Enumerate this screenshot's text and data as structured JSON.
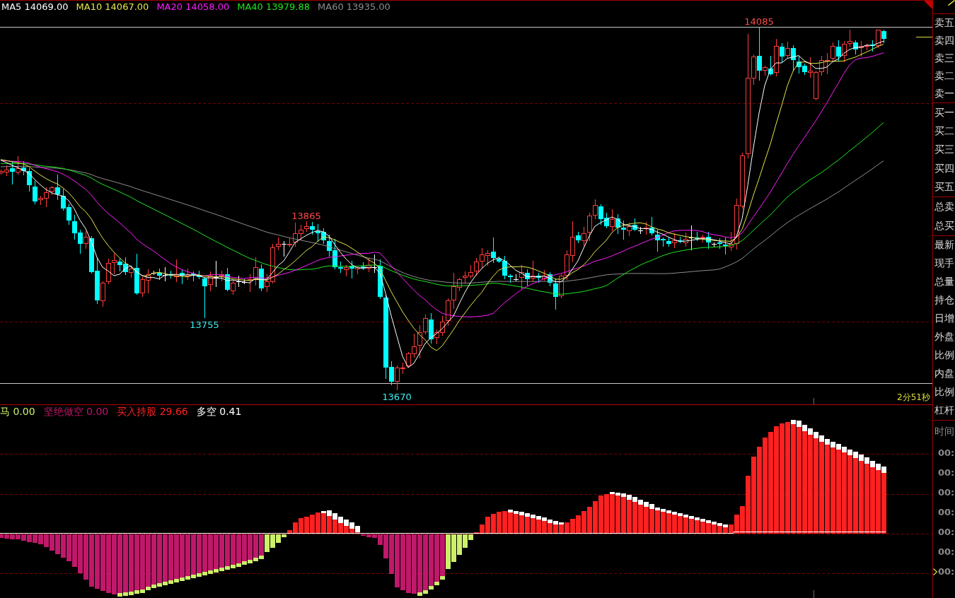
{
  "ma_legend": [
    {
      "text": "MA5 14069.00",
      "color": "#ffffff"
    },
    {
      "text": "MA10 14067.00",
      "color": "#e6e64c"
    },
    {
      "text": "MA20 14058.00",
      "color": "#ff1eff"
    },
    {
      "text": "MA40 13979.88",
      "color": "#1ee61e"
    },
    {
      "text": "MA60 13935.00",
      "color": "#8c8c8c"
    }
  ],
  "main_chart": {
    "price_labels": [
      {
        "text": "14085",
        "kind": "high"
      },
      {
        "text": "13865",
        "kind": "high"
      },
      {
        "text": "13755",
        "kind": "low"
      },
      {
        "text": "13670",
        "kind": "low"
      }
    ],
    "countdown": "2分51秒"
  },
  "indicator_legend": [
    {
      "text": "马 0.00",
      "color": "#ccf06a"
    },
    {
      "text": "坚绝做空 0.00",
      "color": "#c0186a"
    },
    {
      "text": "买入持股 29.66",
      "color": "#ff2020"
    },
    {
      "text": "多空 0.41",
      "color": "#ffffff"
    }
  ],
  "quote_panel": {
    "sell_levels": [
      "卖五",
      "卖四",
      "卖三",
      "卖二",
      "卖一"
    ],
    "buy_levels": [
      "买一",
      "买二",
      "买三",
      "买四",
      "买五"
    ],
    "totals": [
      "总卖",
      "总买"
    ],
    "stats": [
      "最新",
      "现手",
      "总量",
      "持仓",
      "日增",
      "外盘",
      "比例",
      "内盘",
      "比例",
      "杠杆"
    ],
    "trades_header": "时间",
    "trades": [
      {
        "time": "00:",
        "current": false
      },
      {
        "time": "00:",
        "current": false
      },
      {
        "time": "00:",
        "current": false
      },
      {
        "time": "00:",
        "current": false
      },
      {
        "time": "00:",
        "current": false
      },
      {
        "time": "00:",
        "current": false
      },
      {
        "time": "00:",
        "current": true
      }
    ]
  }
}
